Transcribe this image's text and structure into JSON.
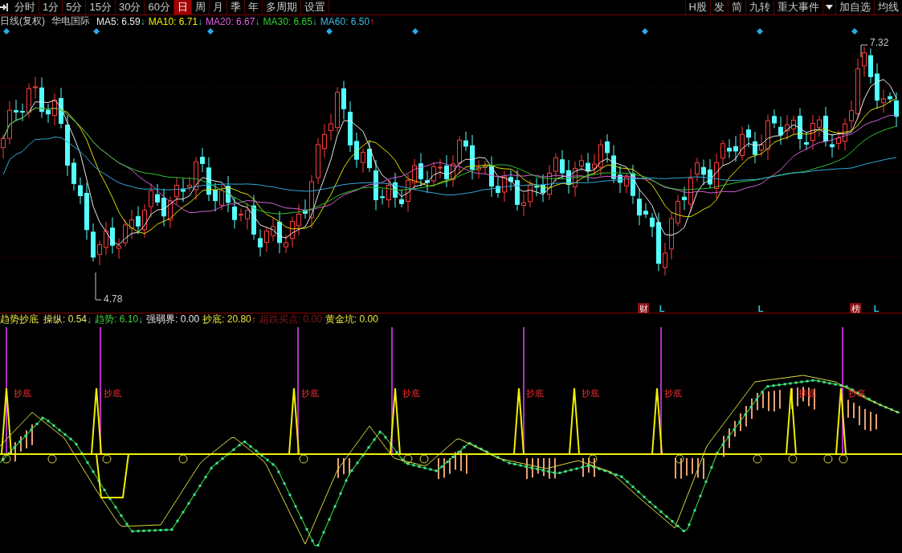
{
  "toolbar": {
    "periods": [
      {
        "label": "分时",
        "selected": false
      },
      {
        "label": "1分",
        "selected": false
      },
      {
        "label": "5分",
        "selected": false
      },
      {
        "label": "15分",
        "selected": false
      },
      {
        "label": "30分",
        "selected": false
      },
      {
        "label": "60分",
        "selected": false
      },
      {
        "label": "日",
        "selected": true
      },
      {
        "label": "周",
        "selected": false
      },
      {
        "label": "月",
        "selected": false
      },
      {
        "label": "季",
        "selected": false
      },
      {
        "label": "年",
        "selected": false
      },
      {
        "label": "多周期",
        "selected": false
      },
      {
        "label": "设置",
        "selected": false
      }
    ],
    "right_buttons": [
      {
        "label": "H股",
        "kind": "button"
      },
      {
        "label": "发",
        "kind": "button"
      },
      {
        "label": "简",
        "kind": "button"
      },
      {
        "label": "九转",
        "kind": "button"
      },
      {
        "label": "重大事件",
        "kind": "button"
      },
      {
        "kind": "dropdown"
      },
      {
        "label": "加自选",
        "kind": "button"
      },
      {
        "label": "均线",
        "kind": "button"
      }
    ]
  },
  "legend": {
    "title": "日线(复权)",
    "stock": "华电国际",
    "averages": [
      {
        "label": "MA5: 6.59",
        "arrow": {
          "text": "↓",
          "kind": "down"
        },
        "color": "#e8e8e8"
      },
      {
        "label": "MA10: 6.71",
        "arrow": {
          "text": "↓",
          "kind": "down"
        },
        "color": "#f0f000"
      },
      {
        "label": "MA20: 6.67",
        "arrow": {
          "text": "↓",
          "kind": "down"
        },
        "color": "#e060e0"
      },
      {
        "label": "MA30: 6.65",
        "arrow": {
          "text": "↓",
          "kind": "down"
        },
        "color": "#30d030"
      },
      {
        "label": "MA60: 6.50",
        "arrow": {
          "text": "↑",
          "kind": "up"
        },
        "color": "#40b8e0"
      }
    ]
  },
  "price_chart": {
    "high_label": "7.32",
    "low_label": "4.78",
    "markers": [
      {
        "text": "财",
        "kind": "badge"
      },
      {
        "text": "L",
        "kind": "letter"
      },
      {
        "text": "L",
        "kind": "letter"
      },
      {
        "text": "榜",
        "kind": "badge"
      },
      {
        "text": "L",
        "kind": "letter"
      }
    ]
  },
  "indicator_legend": {
    "title": "趋势抄底",
    "items": [
      {
        "label": "操纵: 0.54",
        "arrow": {
          "text": "↓",
          "kind": "down"
        },
        "color": "#e6e66e"
      },
      {
        "label": "趋势: 6.10",
        "arrow": {
          "text": "↓",
          "kind": "down"
        },
        "color": "#40d040"
      },
      {
        "label": "强弱界: 0.00",
        "color": "#e8e8e8"
      },
      {
        "label": "抄底: 20.80",
        "arrow": {
          "text": "↑",
          "kind": "up"
        },
        "color": "#e6e640"
      },
      {
        "label": "超跌买点: 0.00",
        "color": "#8a1818"
      },
      {
        "label": "黄金坑: 0.00",
        "color": "#e6e640"
      }
    ]
  },
  "indicator_chart": {
    "signals": [
      "抄底",
      "抄底",
      "抄底",
      "抄底",
      "抄底",
      "抄底",
      "抄底",
      "抄底",
      "抄底"
    ]
  }
}
